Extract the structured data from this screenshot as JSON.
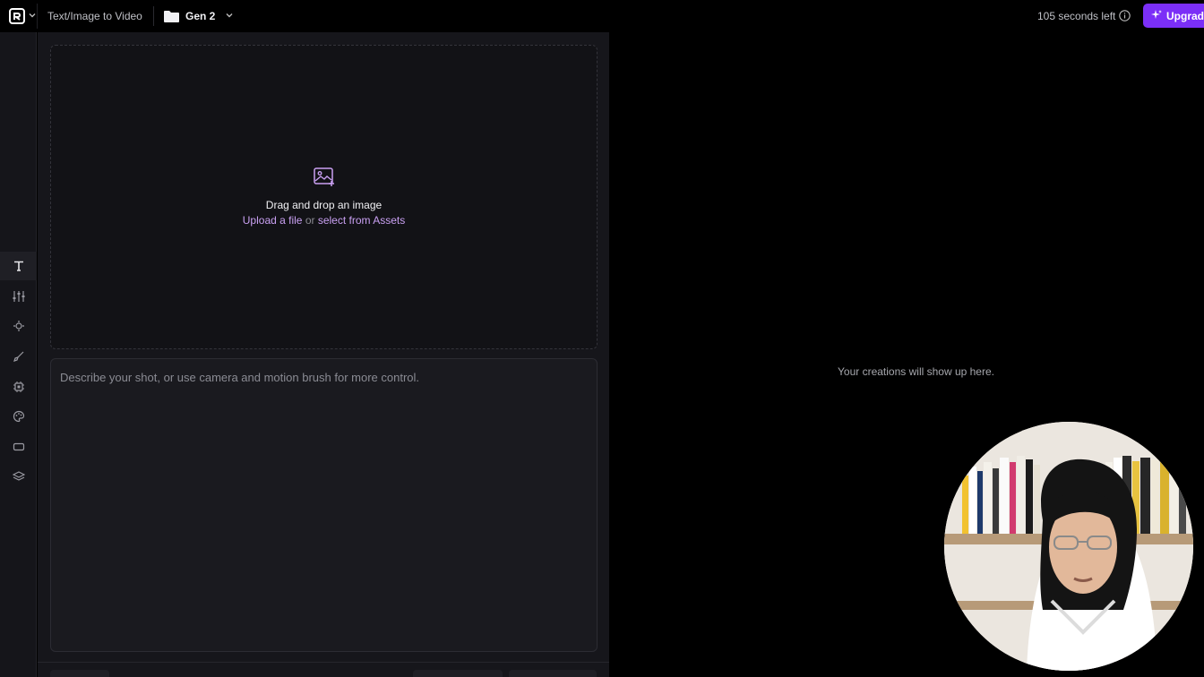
{
  "topbar": {
    "app_title": "Text/Image to Video",
    "project_name": "Gen 2",
    "time_left": "105 seconds left",
    "upgrade_label": "Upgrade"
  },
  "sidebar": {
    "items": [
      {
        "icon": "text-icon",
        "active": true
      },
      {
        "icon": "sliders-icon",
        "active": false
      },
      {
        "icon": "camera-motion-icon",
        "active": false
      },
      {
        "icon": "motion-brush-icon",
        "active": false
      },
      {
        "icon": "processor-icon",
        "active": false
      },
      {
        "icon": "palette-icon",
        "active": false
      },
      {
        "icon": "aspect-ratio-icon",
        "active": false
      },
      {
        "icon": "layers-icon",
        "active": false
      }
    ]
  },
  "dropzone": {
    "title": "Drag and drop an image",
    "upload_link": "Upload a file",
    "or_text": "or",
    "assets_link": "select from Assets"
  },
  "prompt": {
    "placeholder": "Describe your shot, or use camera and motion brush for more control."
  },
  "output": {
    "empty_message": "Your creations will show up here."
  },
  "colors": {
    "accent": "#7b2ff7",
    "link": "#c9a0f2",
    "background": "#000000",
    "panel": "#16161b"
  }
}
